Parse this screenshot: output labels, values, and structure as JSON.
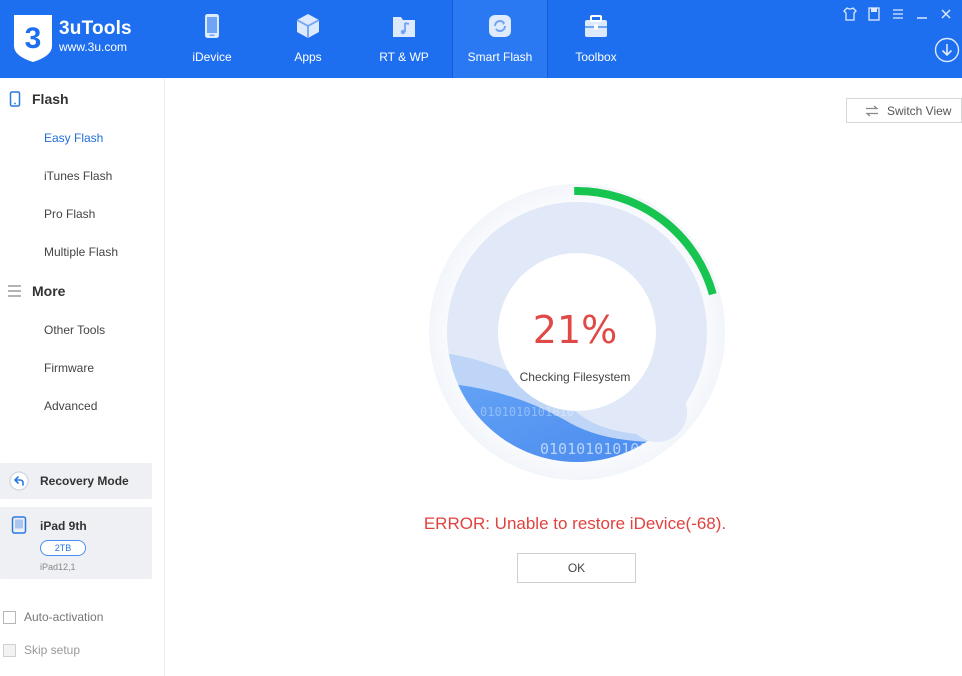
{
  "brand": {
    "name": "3uTools",
    "url": "www.3u.com",
    "logo_glyph": "3"
  },
  "nav": {
    "items": [
      {
        "label": "iDevice",
        "icon": "phone-icon"
      },
      {
        "label": "Apps",
        "icon": "cube-icon"
      },
      {
        "label": "RT & WP",
        "icon": "music-folder-icon"
      },
      {
        "label": "Smart Flash",
        "icon": "refresh-icon",
        "active": true
      },
      {
        "label": "Toolbox",
        "icon": "toolbox-icon"
      }
    ]
  },
  "window_controls": [
    "shirt-icon",
    "note-icon",
    "menu-icon",
    "minimize-icon",
    "close-icon"
  ],
  "sidebar": {
    "flash": {
      "title": "Flash",
      "items": [
        "Easy Flash",
        "iTunes Flash",
        "Pro Flash",
        "Multiple Flash"
      ]
    },
    "more": {
      "title": "More",
      "items": [
        "Other Tools",
        "Firmware",
        "Advanced"
      ]
    },
    "mode": {
      "label": "Recovery Mode"
    },
    "device": {
      "name": "iPad 9th",
      "capacity": "2TB",
      "model": "iPad12,1"
    },
    "options": [
      {
        "label": "Auto-activation",
        "checked": false
      },
      {
        "label": "Skip setup",
        "checked": false
      }
    ]
  },
  "main": {
    "switch_view": "Switch View",
    "progress": {
      "percent_text": "21%",
      "fraction": 0.21,
      "status": "Checking Filesystem"
    },
    "binary_text_1": "0101010101010",
    "binary_text_2": "0101010101010",
    "error": "ERROR: Unable to restore iDevice(-68).",
    "ok": "OK"
  },
  "colors": {
    "topbar": "#1e6ff0",
    "accent": "#1f6fd6",
    "progress": "#17c44f",
    "error": "#e0433f"
  }
}
